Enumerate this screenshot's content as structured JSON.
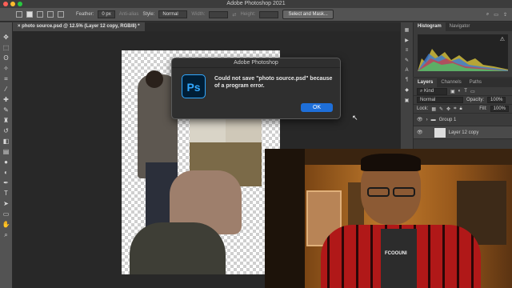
{
  "window": {
    "title": "Adobe Photoshop 2021"
  },
  "options_bar": {
    "feather_label": "Feather:",
    "feather_value": "0 px",
    "anti_alias_label": "Anti-alias",
    "style_label": "Style:",
    "style_value": "Normal",
    "width_label": "Width:",
    "height_label": "Height:",
    "select_mask_label": "Select and Mask..."
  },
  "document_tab": {
    "label": "photo source.psd @ 12.5% (Layer 12 copy, RGB/8) *"
  },
  "dialog": {
    "title": "Adobe Photoshop",
    "logo_text": "Ps",
    "message": "Could not save \"photo source.psd\" because of a program error.",
    "ok_label": "OK"
  },
  "panels": {
    "histogram_tab": "Histogram",
    "navigator_tab": "Navigator",
    "layers_tab": "Layers",
    "channels_tab": "Channels",
    "paths_tab": "Paths",
    "kind_label": "Kind",
    "blend_mode": "Normal",
    "opacity_label": "Opacity:",
    "opacity_value": "100%",
    "lock_label": "Lock:",
    "fill_label": "Fill:",
    "fill_value": "100%",
    "layers": [
      {
        "name": "Group 1"
      },
      {
        "name": "Layer 12 copy"
      }
    ]
  },
  "webcam": {
    "shirt_text": "FCOOUNI"
  },
  "icons": {
    "toolbar": [
      "move-icon",
      "marquee-icon",
      "lasso-icon",
      "magic-wand-icon",
      "crop-icon",
      "eyedropper-icon",
      "healing-icon",
      "brush-icon",
      "stamp-icon",
      "history-brush-icon",
      "eraser-icon",
      "gradient-icon",
      "blur-icon",
      "dodge-icon",
      "pen-icon",
      "type-icon",
      "path-select-icon",
      "shape-icon",
      "hand-icon",
      "zoom-icon"
    ]
  },
  "colors": {
    "accent": "#1e6fd9",
    "ps_logo_bg": "#001e36",
    "ps_logo_fg": "#31a8ff"
  }
}
